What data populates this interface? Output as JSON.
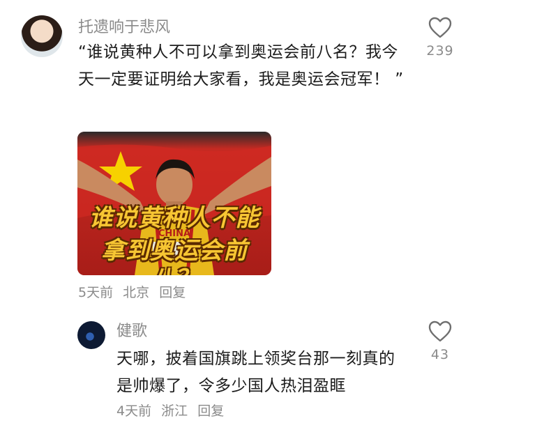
{
  "comment": {
    "username": "托遗响于悲风",
    "text": "“谁说黄种人不可以拿到奥运会前八名？我今天一定要证明给大家看，我是奥运会冠军！ ”",
    "image": {
      "caption_line1": "谁说黄种人不能",
      "caption_line2": "拿到奥运会前八？",
      "jersey_text": "CHINA"
    },
    "time": "5天前",
    "location": "北京",
    "reply_label": "回复",
    "likes": "239"
  },
  "reply": {
    "username": "健歌",
    "text": "天哪，披着国旗跳上领奖台那一刻真的是帅爆了，令多少国人热泪盈眶",
    "time": "4天前",
    "location": "浙江",
    "reply_label": "回复",
    "likes": "43"
  },
  "icons": {
    "like": "heart-outline-icon"
  },
  "colors": {
    "secondary_text": "#8a8a8a",
    "flag_red": "#c8231d",
    "flag_star": "#f7d100",
    "caption_yellow": "#f7c633"
  }
}
